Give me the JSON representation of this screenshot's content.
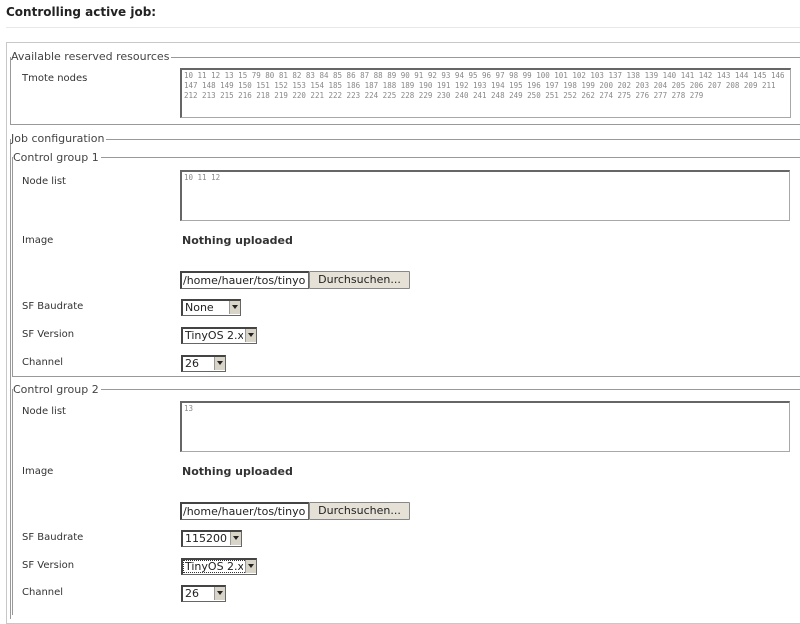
{
  "page": {
    "title": "Controlling active job:"
  },
  "resources": {
    "legend": "Available reserved resources",
    "tmote_label": "Tmote nodes",
    "tmote_nodes": "10 11 12 13 15 79 80 81 82 83 84 85 86 87 88 89 90 91 92 93 94 95 96 97 98 99 100 101 102 103 137 138 139 140 141 142 143 144 145 146 147 148 149 150 151 152 153 154 185 186 187 188 189 190 191 192 193 194 195 196 197 198 199 200 202 203 204 205 206 207 208 209 211 212 213 215 216 218 219 220 221 222 223 224 225 228 229 230 240 241 248 249 250 251 252 262 274 275 276 277 278 279"
  },
  "job": {
    "legend": "Job configuration"
  },
  "groups": [
    {
      "legend": "Control group 1",
      "node_list_label": "Node list",
      "node_list": "10 11 12",
      "image_label": "Image",
      "image_status": "Nothing uploaded",
      "file_path": "/home/hauer/tos/tinyo",
      "browse_label": "Durchsuchen...",
      "baudrate_label": "SF Baudrate",
      "baudrate": "None",
      "version_label": "SF Version",
      "version": "TinyOS 2.x",
      "channel_label": "Channel",
      "channel": "26"
    },
    {
      "legend": "Control group 2",
      "node_list_label": "Node list",
      "node_list": "13",
      "image_label": "Image",
      "image_status": "Nothing uploaded",
      "file_path": "/home/hauer/tos/tinyo",
      "browse_label": "Durchsuchen...",
      "baudrate_label": "SF Baudrate",
      "baudrate": "115200",
      "version_label": "SF Version",
      "version": "TinyOS 2.x",
      "channel_label": "Channel",
      "channel": "26"
    }
  ]
}
